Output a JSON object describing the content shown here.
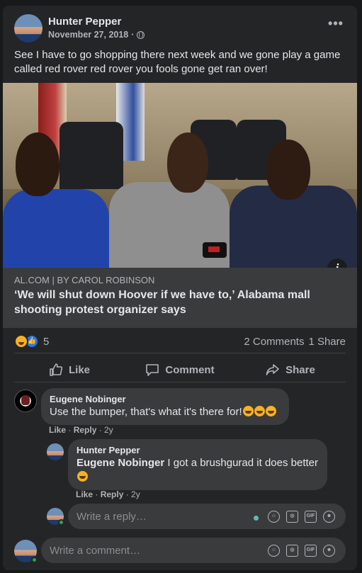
{
  "post": {
    "author": "Hunter Pepper",
    "date": "November 27, 2018",
    "separator": "·",
    "text": "See I have to go shopping there next week and we gone play a game called red rover red rover you fools gone get ran over!"
  },
  "link": {
    "source": "AL.COM | BY CAROL ROBINSON",
    "title": "‘We will shut down Hoover if we have to,’ Alabama mall shooting protest organizer says"
  },
  "stats": {
    "reaction_count": "5",
    "comments": "2 Comments",
    "shares": "1 Share"
  },
  "actions": {
    "like": "Like",
    "comment": "Comment",
    "share": "Share"
  },
  "comments": [
    {
      "author": "Eugene Nobinger",
      "text": "Use the bumper, that's what it's there for!",
      "like": "Like",
      "reply": "Reply",
      "age": "2y"
    }
  ],
  "reply": {
    "author": "Hunter Pepper",
    "mention": "Eugene Nobinger",
    "text": " I got a brushgurad it does better",
    "like": "Like",
    "reply": "Reply",
    "age": "2y"
  },
  "inputs": {
    "reply_placeholder": "Write a reply…",
    "comment_placeholder": "Write a comment…"
  },
  "colors": {
    "card": "#242526",
    "bubble": "#3a3b3c",
    "like_blue": "#2078f4",
    "haha_yellow": "#f7b125"
  }
}
